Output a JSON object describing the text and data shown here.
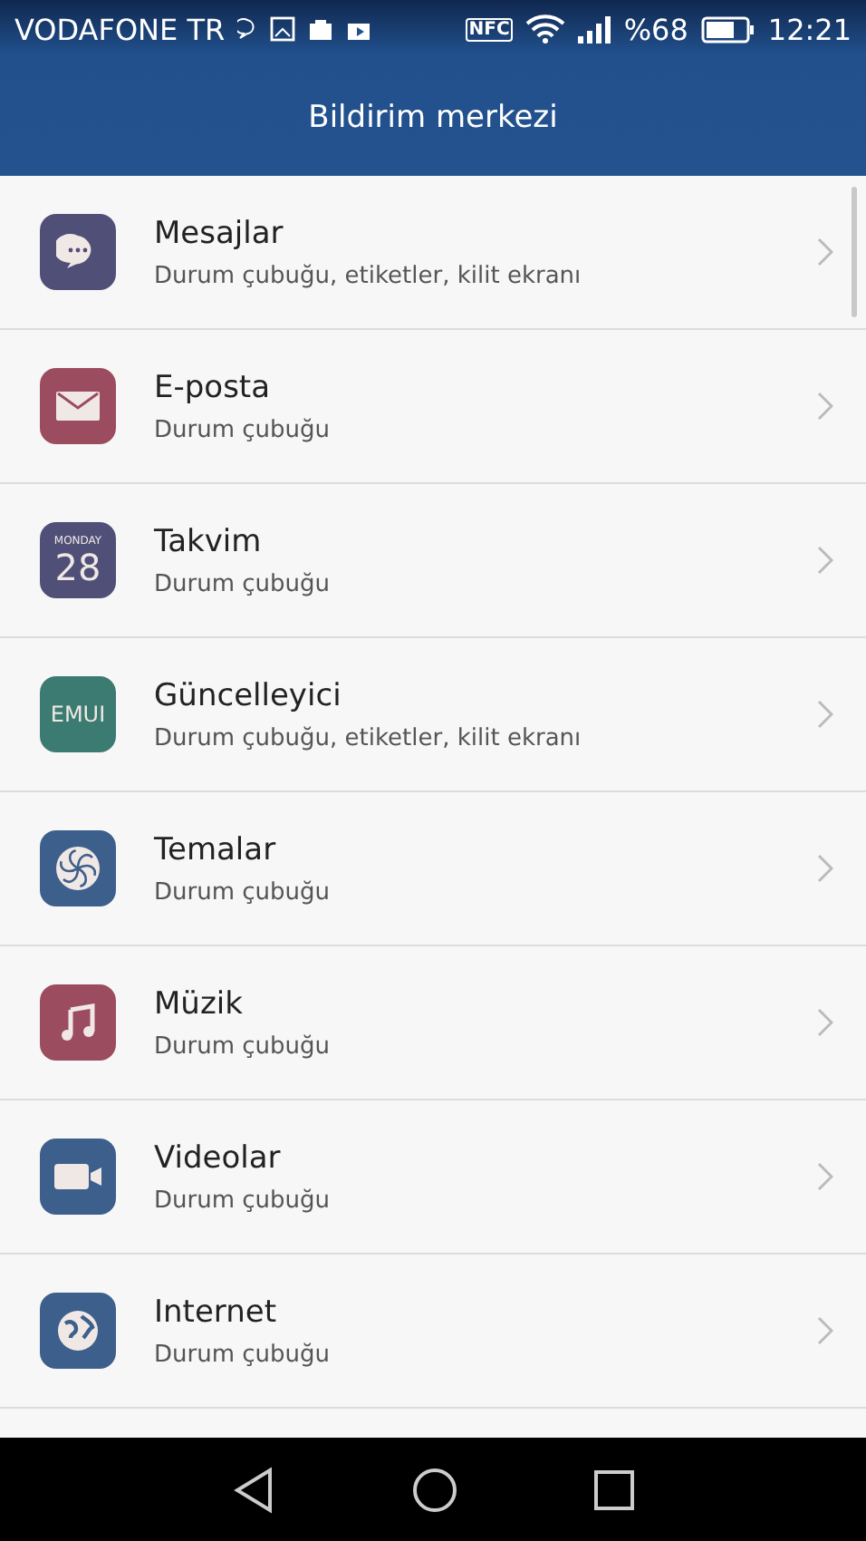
{
  "status_bar": {
    "carrier": "VODAFONE TR",
    "nfc": "NFC",
    "battery": "%68",
    "time": "12:21"
  },
  "header": {
    "title": "Bildirim merkezi"
  },
  "apps": [
    {
      "kind": "messages",
      "name": "Mesajlar",
      "detail": "Durum çubuğu, etiketler, kilit ekranı"
    },
    {
      "kind": "email",
      "name": "E-posta",
      "detail": "Durum çubuğu"
    },
    {
      "kind": "calendar",
      "name": "Takvim",
      "detail": "Durum çubuğu",
      "icon_label": "MONDAY",
      "icon_value": "28"
    },
    {
      "kind": "updater",
      "name": "Güncelleyici",
      "detail": "Durum çubuğu, etiketler, kilit ekranı",
      "icon_label": "EMUI"
    },
    {
      "kind": "themes",
      "name": "Temalar",
      "detail": "Durum çubuğu"
    },
    {
      "kind": "music",
      "name": "Müzik",
      "detail": "Durum çubuğu"
    },
    {
      "kind": "videos",
      "name": "Videolar",
      "detail": "Durum çubuğu"
    },
    {
      "kind": "internet",
      "name": "Internet",
      "detail": "Durum çubuğu"
    }
  ]
}
